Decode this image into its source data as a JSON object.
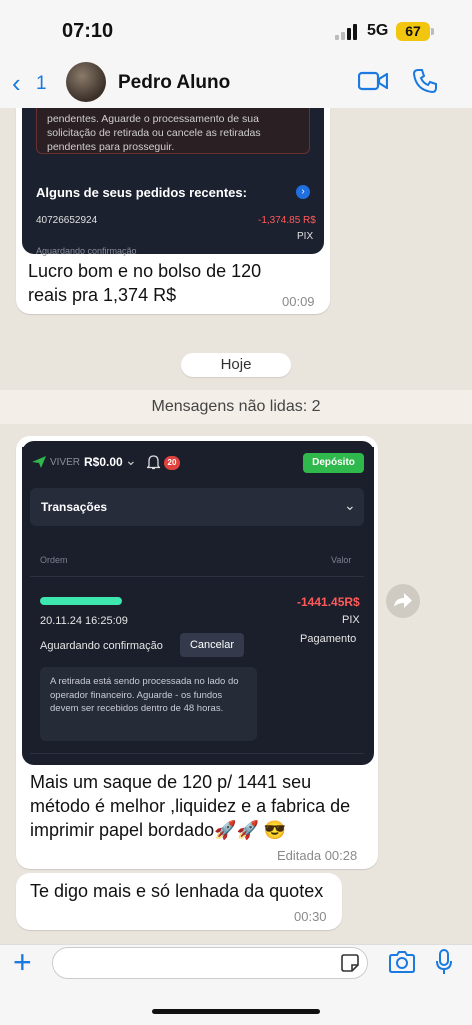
{
  "status": {
    "time": "07:10",
    "network": "5G",
    "battery": "67"
  },
  "header": {
    "back_count": "1",
    "contact_name": "Pedro Aluno"
  },
  "msg1": {
    "warning_text": "pendentes. Aguarde o processamento de sua solicitação de retirada ou cancele as retiradas pendentes para prosseguir.",
    "recent_title": "Alguns de seus pedidos recentes:",
    "order_id": "40726652924",
    "amount": "-1,374.85 R$",
    "method": "PIX",
    "status": "Aguardando confirmação",
    "text": "Lucro bom e no bolso  de 120 reais pra 1,374 R$",
    "time": "00:09"
  },
  "day_pill": "Hoje",
  "unread_label": "Mensagens não lidas: 2",
  "msg2": {
    "brand": "VIVER",
    "balance": "R$0.00",
    "notif_count": "20",
    "deposit_label": "Depósito",
    "section_title": "Transações",
    "col_order": "Ordem",
    "col_value": "Valor",
    "datetime": "20.11.24 16:25:09",
    "amount": "-1441.45R$",
    "method": "PIX",
    "type": "Pagamento",
    "status": "Aguardando confirmação",
    "cancel_label": "Cancelar",
    "info": "A retirada está sendo processada no lado do operador financeiro. Aguarde - os fundos devem ser recebidos dentro de 48 horas.",
    "text": "Mais um saque de 120 p/ 1441 seu método é melhor ,liquidez e a fabrica de imprimir papel bordado🚀🚀 😎",
    "time": "Editada 00:28"
  },
  "msg3": {
    "text": "Te digo mais e só lenhada da quotex",
    "time": "00:30"
  },
  "colors": {
    "accent": "#1a7ae0",
    "deposit": "#2fb84b",
    "negative": "#ff5a5a"
  }
}
